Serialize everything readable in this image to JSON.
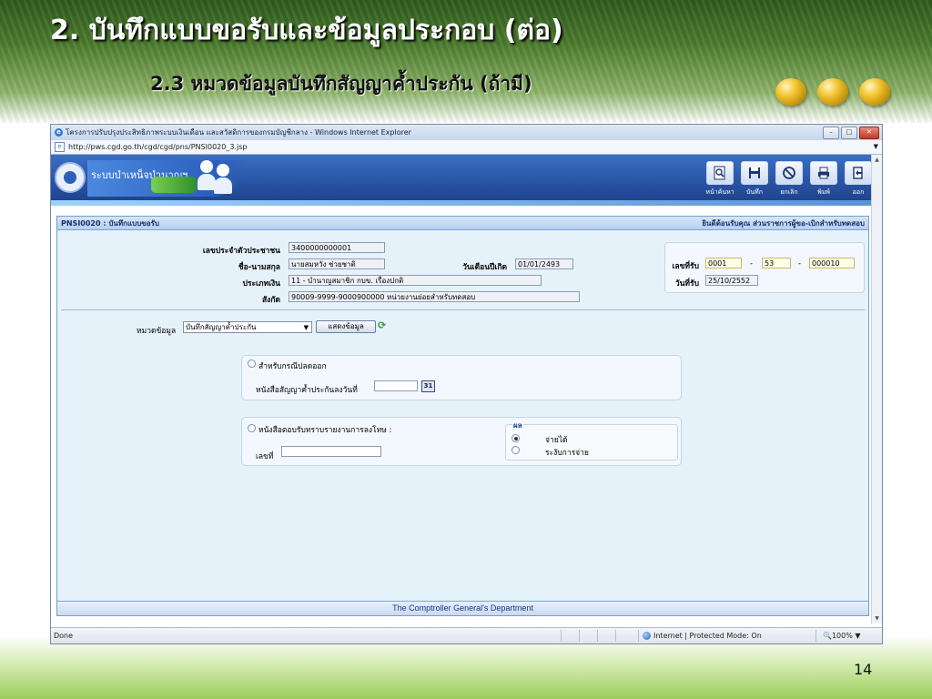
{
  "slide": {
    "title": "2. บันทึกแบบขอรับและข้อมูลประกอบ (ต่อ)",
    "subtitle": "2.3 หมวดข้อมูลบันทึกสัญญาค้ำประกัน (ถ้ามี)",
    "page_number": "14"
  },
  "browser": {
    "window_title": "โครงการปรับปรุงประสิทธิภาพระบบเงินเดือน และสวัสดิการของกรมบัญชีกลาง - Windows Internet Explorer",
    "address": "http://pws.cgd.go.th/cgd/cgd/pns/PNSI0020_3.jsp",
    "status_text": "Done",
    "security_zone": "Internet | Protected Mode: On",
    "zoom": "100%"
  },
  "app": {
    "system_name": "ระบบบำเหน็จบำนาญฯ",
    "toolbar": [
      {
        "label": "หน้าค้นหา",
        "icon": "search-icon"
      },
      {
        "label": "บันทึก",
        "icon": "save-icon"
      },
      {
        "label": "ยกเลิก",
        "icon": "cancel-icon"
      },
      {
        "label": "พิมพ์",
        "icon": "print-icon"
      },
      {
        "label": "ออก",
        "icon": "exit-icon"
      }
    ],
    "module_title": "PNSI0020 : บันทึกแบบขอรับ",
    "welcome_text": "ยินดีต้อนรับคุณ ส่วนราชการผู้ขอ-เบิกสำหรับทดสอบ",
    "footer": "The Comptroller General's Department"
  },
  "form": {
    "citizen_id_label": "เลขประจำตัวประชาชน",
    "citizen_id": "3400000000001",
    "name_label": "ชื่อ-นามสกุล",
    "name": "นายสมหวัง ช่วยชาติ",
    "birthdate_label": "วันเดือนปีเกิด",
    "birthdate": "01/01/2493",
    "money_type_label": "ประเภทเงิน",
    "money_type": "11 - บำนาญสมาชิก กบข. เรื่องปกติ",
    "affiliation_label": "สังกัด",
    "affiliation": "90009-9999-9000900000  หน่วยงานย่อยสำหรับทดสอบ",
    "receipt_no_label": "เลขที่รับ",
    "receipt_no_1": "0001",
    "receipt_no_2": "53",
    "receipt_no_3": "000010",
    "dash": "-",
    "receipt_date_label": "วันที่รับ",
    "receipt_date": "25/10/2552",
    "category_label": "หมวดข้อมูล",
    "category_value": "บันทึกสัญญาค้ำประกัน",
    "show_button": "แสดงข้อมูล",
    "option_release_label": "สำหรับกรณีปลดออก",
    "guarantee_date_label": "หนังสือสัญญาค้ำประกันลงวันที่",
    "guarantee_date": "",
    "calendar_label": "31",
    "option_ack_label": "หนังสือตอบรับทราบรายงานการลงโทษ :",
    "doc_no_label": "เลขที่",
    "doc_no": "",
    "result_legend": "ผล",
    "result_options": [
      "จ่ายได้",
      "ระงับการจ่าย"
    ]
  }
}
